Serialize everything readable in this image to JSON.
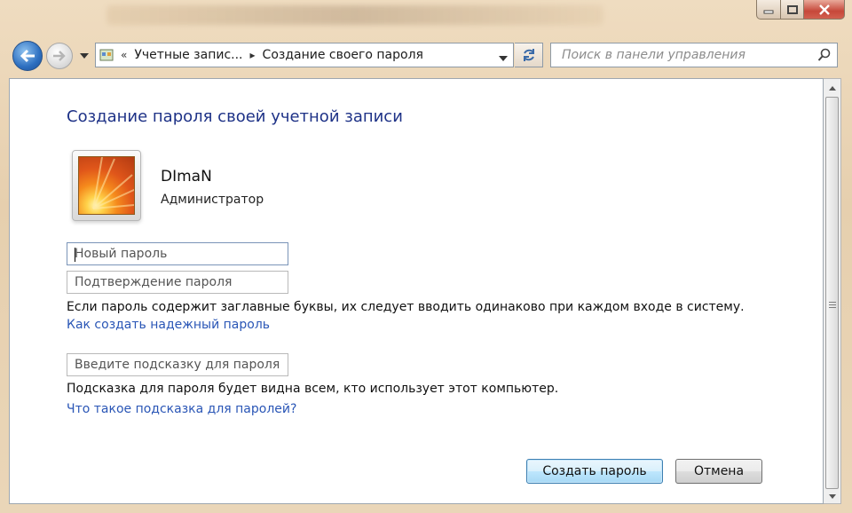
{
  "nav": {
    "breadcrumb": [
      "Учетные запис...",
      "Создание своего пароля"
    ],
    "search_placeholder": "Поиск в панели управления"
  },
  "page": {
    "heading": "Создание пароля своей учетной записи",
    "user": {
      "name": "DImaN",
      "role": "Администратор"
    },
    "new_password_placeholder": "Новый пароль",
    "confirm_password_placeholder": "Подтверждение пароля",
    "case_note": "Если пароль содержит заглавные буквы, их следует вводить одинаково при каждом входе в систему.",
    "strong_password_link": "Как создать надежный пароль",
    "hint_placeholder": "Введите подсказку для пароля",
    "hint_note": "Подсказка для пароля будет видна всем, кто использует этот компьютер.",
    "hint_link": "Что такое подсказка для паролей?",
    "create_button": "Создать пароль",
    "cancel_button": "Отмена"
  },
  "icons": {
    "back": "back-arrow-icon",
    "forward": "forward-arrow-icon",
    "control_panel": "control-panel-icon",
    "refresh": "refresh-icon",
    "search": "search-icon"
  },
  "colors": {
    "heading": "#1e3287",
    "link": "#2a56b6",
    "primary_button": "#bee6fd"
  }
}
